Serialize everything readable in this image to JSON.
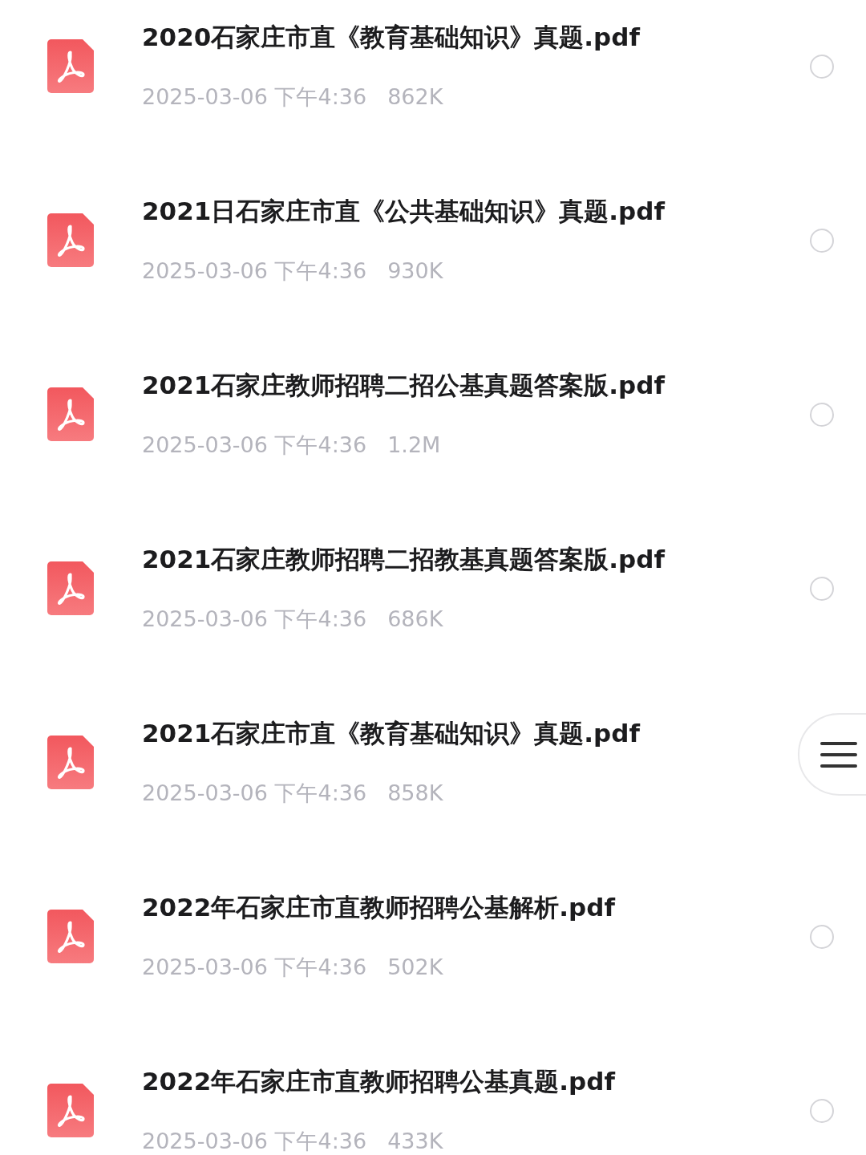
{
  "files": [
    {
      "name": "2020石家庄市直《教育基础知识》真题.pdf",
      "date": "2025-03-06 下午4:36",
      "size": "862K",
      "selected": false
    },
    {
      "name": "2021日石家庄市直《公共基础知识》真题.pdf",
      "date": "2025-03-06 下午4:36",
      "size": "930K",
      "selected": false
    },
    {
      "name": "2021石家庄教师招聘二招公基真题答案版.pdf",
      "date": "2025-03-06 下午4:36",
      "size": "1.2M",
      "selected": false
    },
    {
      "name": "2021石家庄教师招聘二招教基真题答案版.pdf",
      "date": "2025-03-06 下午4:36",
      "size": "686K",
      "selected": false
    },
    {
      "name": "2021石家庄市直《教育基础知识》真题.pdf",
      "date": "2025-03-06 下午4:36",
      "size": "858K"
    },
    {
      "name": "2022年石家庄市直教师招聘公基解析.pdf",
      "date": "2025-03-06 下午4:36",
      "size": "502K",
      "selected": false
    },
    {
      "name": "2022年石家庄市直教师招聘公基真题.pdf",
      "date": "2025-03-06 下午4:36",
      "size": "433K",
      "selected": false
    }
  ]
}
